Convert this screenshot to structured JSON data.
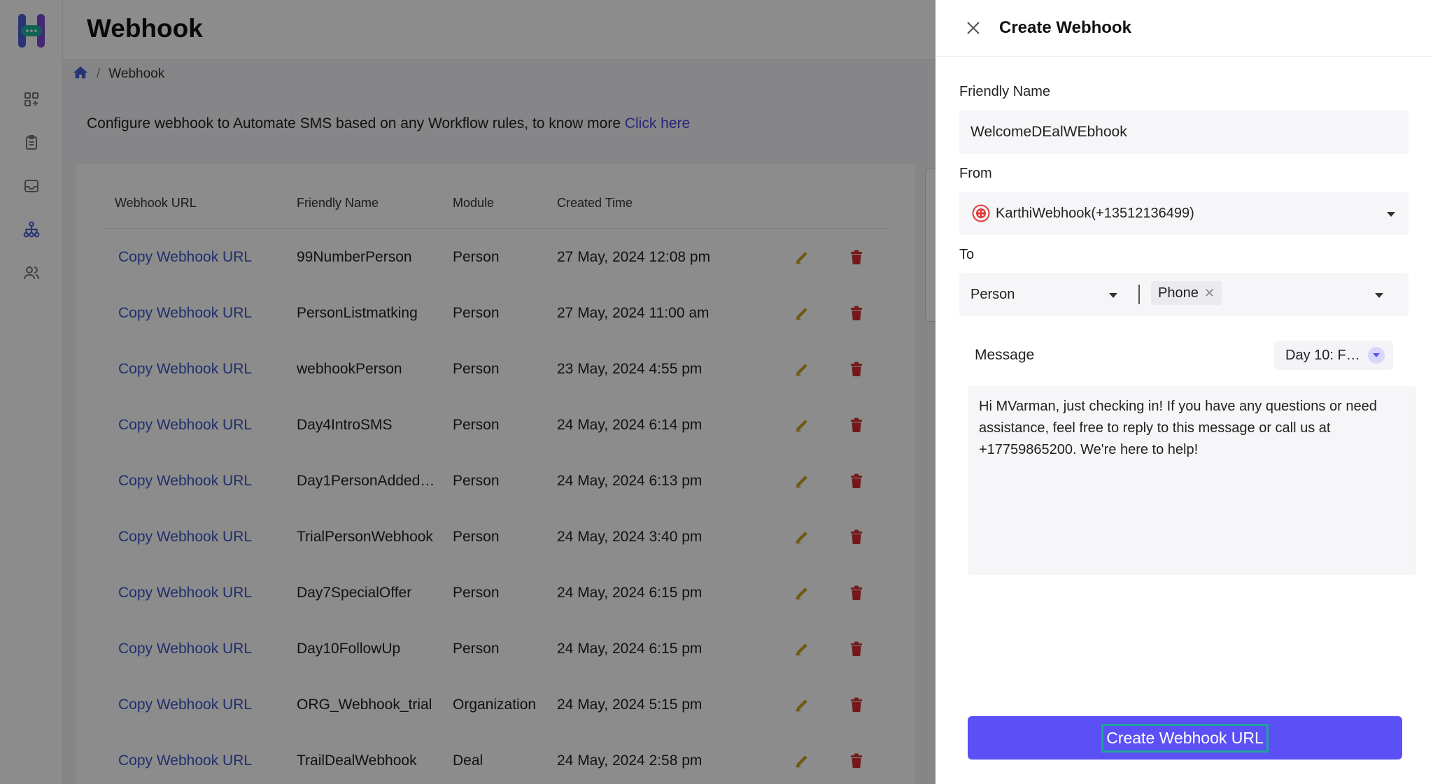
{
  "app": {
    "page_title": "Webhook",
    "breadcrumb": {
      "current": "Webhook"
    },
    "intro": {
      "text": "Configure webhook to Automate SMS based on any Workflow rules, to know more ",
      "link_label": "Click here"
    }
  },
  "rail": {
    "icons": [
      "apps-icon",
      "clipboard-icon",
      "inbox-icon",
      "workflow-icon",
      "users-icon"
    ]
  },
  "table": {
    "columns": [
      "Webhook URL",
      "Friendly Name",
      "Module",
      "Created Time"
    ],
    "rows": [
      {
        "url_label": "Copy Webhook URL",
        "name": "99NumberPerson",
        "module": "Person",
        "created": "27 May, 2024 12:08 pm"
      },
      {
        "url_label": "Copy Webhook URL",
        "name": "PersonListmatking",
        "module": "Person",
        "created": "27 May, 2024 11:00 am"
      },
      {
        "url_label": "Copy Webhook URL",
        "name": "webhookPerson",
        "module": "Person",
        "created": "23 May, 2024 4:55 pm"
      },
      {
        "url_label": "Copy Webhook URL",
        "name": "Day4IntroSMS",
        "module": "Person",
        "created": "24 May, 2024 6:14 pm"
      },
      {
        "url_label": "Copy Webhook URL",
        "name": "Day1PersonAdded…",
        "module": "Person",
        "created": "24 May, 2024 6:13 pm"
      },
      {
        "url_label": "Copy Webhook URL",
        "name": "TrialPersonWebhook",
        "module": "Person",
        "created": "24 May, 2024 3:40 pm"
      },
      {
        "url_label": "Copy Webhook URL",
        "name": "Day7SpecialOffer",
        "module": "Person",
        "created": "24 May, 2024 6:15 pm"
      },
      {
        "url_label": "Copy Webhook URL",
        "name": "Day10FollowUp",
        "module": "Person",
        "created": "24 May, 2024 6:15 pm"
      },
      {
        "url_label": "Copy Webhook URL",
        "name": "ORG_Webhook_trial",
        "module": "Organization",
        "created": "24 May, 2024 5:15 pm"
      },
      {
        "url_label": "Copy Webhook URL",
        "name": "TrailDealWebhook",
        "module": "Deal",
        "created": "24 May, 2024 2:58 pm"
      }
    ]
  },
  "drawer": {
    "title": "Create Webhook",
    "friendly_name_label": "Friendly Name",
    "friendly_name_value": "WelcomeDEalWEbhook",
    "from_label": "From",
    "from_value": "KarthiWebhook(+13512136499)",
    "to_label": "To",
    "to_module": "Person",
    "to_chip": "Phone",
    "message_label": "Message",
    "template_value": "Day 10: F…",
    "message_text": "Hi MVarman,  just checking in! If you have any questions or need assistance, feel free to reply to this message or call us at +17759865200. We're here to help!",
    "submit_label": "Create Webhook URL"
  },
  "colors": {
    "accent": "#5b50f5",
    "link": "#3a56c8",
    "edit_icon": "#c9a227",
    "delete_icon": "#d32f2f"
  }
}
